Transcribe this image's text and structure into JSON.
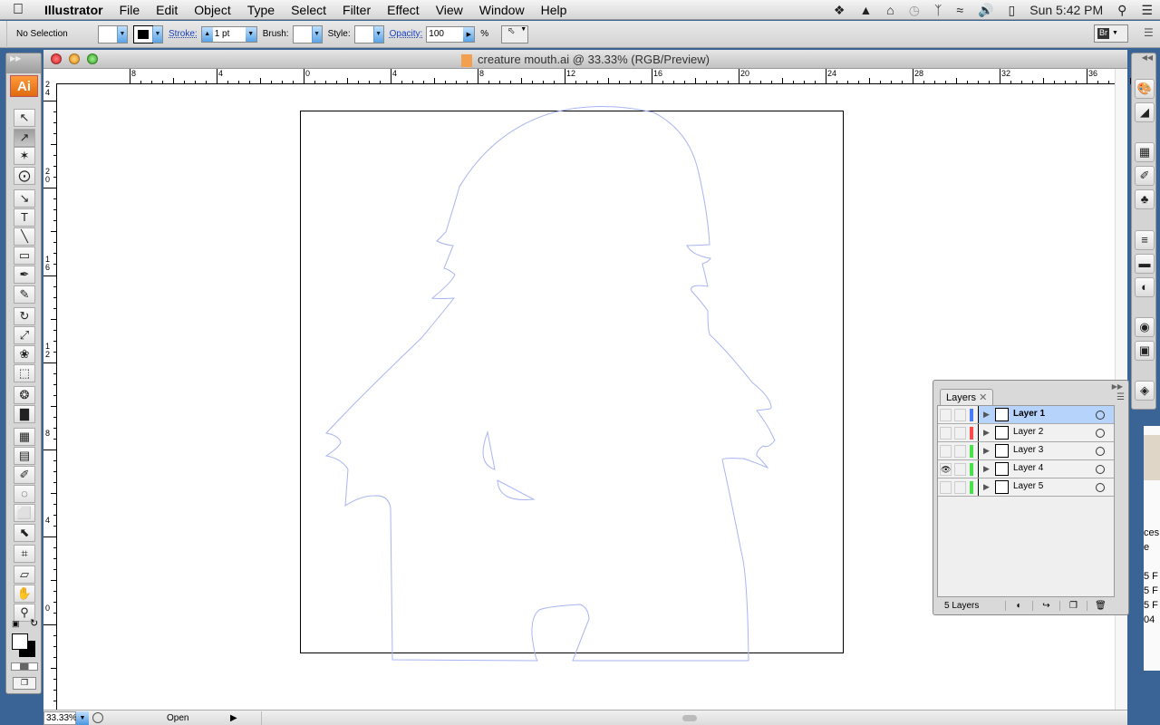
{
  "menubar": {
    "apple_icon": "apple-icon",
    "app": "Illustrator",
    "items": [
      "File",
      "Edit",
      "Object",
      "Type",
      "Select",
      "Filter",
      "Effect",
      "View",
      "Window",
      "Help"
    ],
    "status_icons": [
      "dropbox-icon",
      "airplay-icon",
      "home-sharing-icon",
      "time-machine-icon",
      "bluetooth-icon",
      "wifi-icon",
      "volume-icon",
      "battery-icon"
    ],
    "clock": "Sun 5:42 PM",
    "spotlight_icon": "search-icon",
    "notification_icon": "list-icon"
  },
  "controlbar": {
    "selection": "No Selection",
    "stroke_label": "Stroke:",
    "stroke_value": "1 pt",
    "brush_label": "Brush:",
    "style_label": "Style:",
    "opacity_label": "Opacity:",
    "opacity_value": "100",
    "opacity_unit": "%"
  },
  "document": {
    "title": "creature mouth.ai @ 33.33% (RGB/Preview)",
    "zoom": "33.33%",
    "status": "Open",
    "ruler_h": [
      "8",
      "4",
      "0",
      "4",
      "8",
      "12",
      "16",
      "20",
      "24",
      "28",
      "32",
      "36"
    ],
    "ruler_v": [
      "24",
      "20",
      "16",
      "12",
      "8",
      "4",
      "0"
    ],
    "stroke_color": "#a9b4f2"
  },
  "tools": {
    "logo": "Ai",
    "items": [
      "selection-tool",
      "direct-selection-tool",
      "magic-wand-tool",
      "lasso-tool",
      "pen-tool",
      "type-tool",
      "line-tool",
      "rectangle-tool",
      "paintbrush-tool",
      "pencil-tool",
      "rotate-tool",
      "scale-tool",
      "warp-tool",
      "free-transform-tool",
      "symbol-sprayer-tool",
      "graph-tool",
      "mesh-tool",
      "gradient-tool",
      "eyedropper-tool",
      "blend-tool",
      "live-paint-tool",
      "live-paint-selection-tool",
      "slice-tool",
      "eraser-tool",
      "hand-tool",
      "zoom-tool"
    ]
  },
  "dock": {
    "items": [
      "color-icon",
      "color-guide-icon",
      "swatches-icon",
      "brushes-icon",
      "symbols-icon",
      "stroke-icon",
      "gradient-icon",
      "transparency-icon",
      "appearance-icon",
      "graphic-styles-icon",
      "layers-icon"
    ]
  },
  "layers": {
    "tab": "Layers",
    "rows": [
      {
        "name": "Layer 1",
        "color": "#4a7bff",
        "visible": false,
        "selected": true
      },
      {
        "name": "Layer 2",
        "color": "#ff4a4a",
        "visible": false,
        "selected": false
      },
      {
        "name": "Layer 3",
        "color": "#4ae04a",
        "visible": false,
        "selected": false
      },
      {
        "name": "Layer 4",
        "color": "#4ae04a",
        "visible": true,
        "selected": false
      },
      {
        "name": "Layer 5",
        "color": "#4ae04a",
        "visible": false,
        "selected": false
      }
    ],
    "count": "5 Layers"
  },
  "background_window": {
    "snippets": [
      "ces",
      "e",
      "5 F",
      "5 F",
      "5 F",
      "04"
    ]
  }
}
